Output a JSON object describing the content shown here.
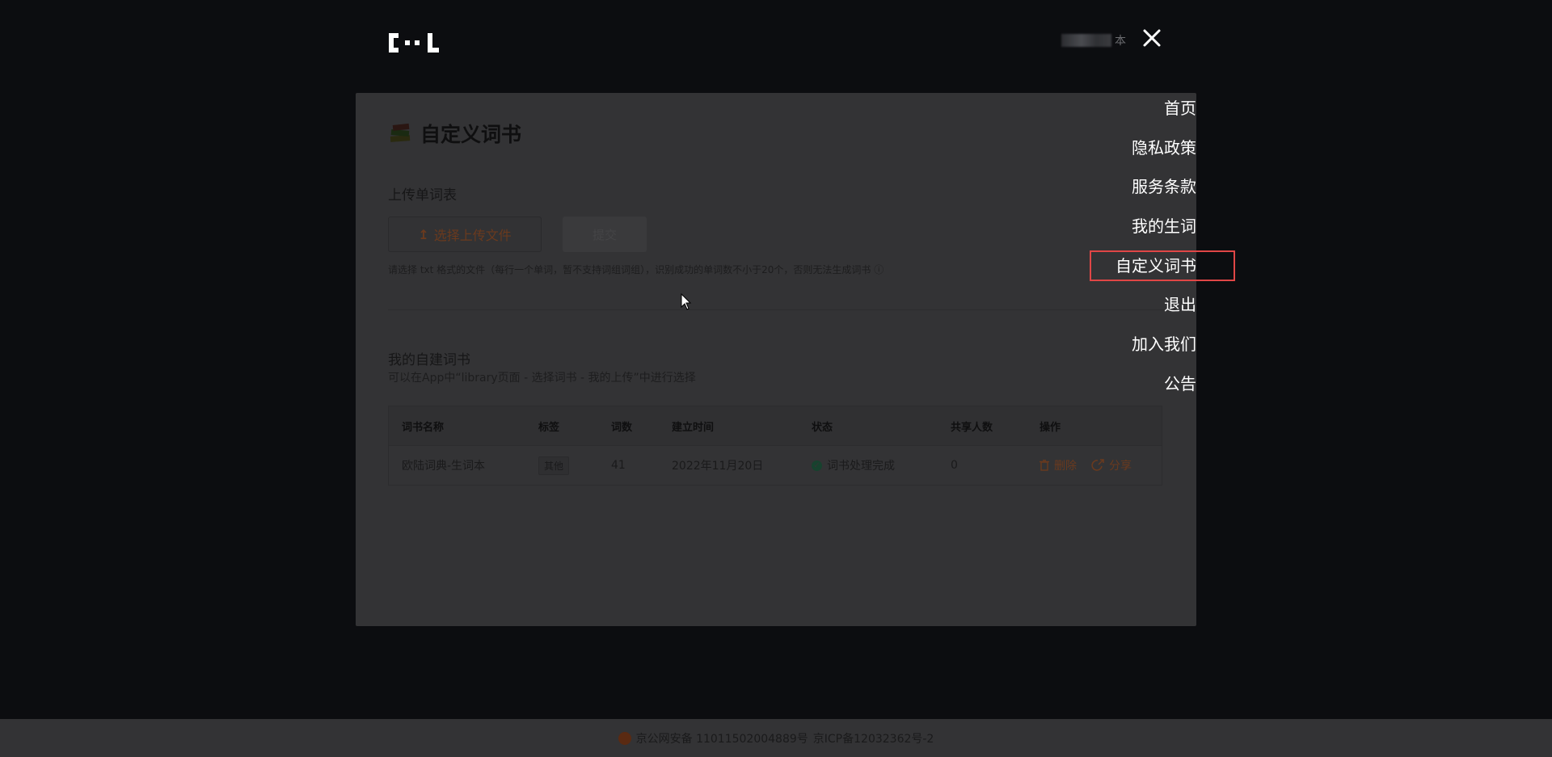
{
  "header": {
    "logo_alt": "C··L",
    "user_suffix": "本",
    "close_label": "×"
  },
  "card": {
    "title": "自定义词书",
    "upload_section_title": "上传单词表",
    "upload_button_label": "选择上传文件",
    "submit_button_label": "提交",
    "upload_hint": "请选择 txt 格式的文件（每行一个单词，暂不支持词组词组），识别成功的单词数不小于20个，否则无法生成词书",
    "my_books_title": "我的自建词书",
    "my_books_hint": "可以在App中“library页面 - 选择词书 - 我的上传”中进行选择",
    "table": {
      "headers": [
        "词书名称",
        "标签",
        "词数",
        "建立时间",
        "状态",
        "共享人数",
        "操作"
      ],
      "rows": [
        {
          "name": "欧陆词典-生词本",
          "tag": "其他",
          "count": "41",
          "created": "2022年11月20日",
          "status": "词书处理完成",
          "shared": "0",
          "delete_label": "删除",
          "share_label": "分享"
        }
      ]
    }
  },
  "menu": {
    "items": [
      {
        "label": "首页",
        "active": false
      },
      {
        "label": "隐私政策",
        "active": false
      },
      {
        "label": "服务条款",
        "active": false
      },
      {
        "label": "我的生词",
        "active": false
      },
      {
        "label": "自定义词书",
        "active": true
      },
      {
        "label": "退出",
        "active": false
      },
      {
        "label": "加入我们",
        "active": false
      },
      {
        "label": "公告",
        "active": false
      }
    ]
  },
  "footer": {
    "police_record": "京公网安备 11011502004889号",
    "icp_record": "京ICP备12032362号-2"
  },
  "colors": {
    "background": "#0c0d10",
    "card_dimmed": "#333335",
    "menu_text": "#ffffff",
    "active_border": "#e04646"
  }
}
